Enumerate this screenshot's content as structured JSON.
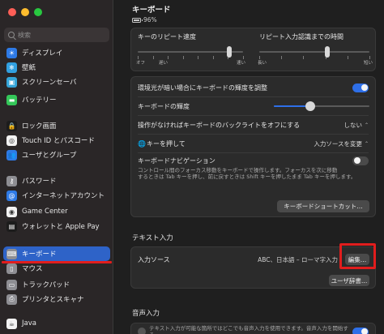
{
  "window": {
    "traffic_lights": [
      "#ff5f57",
      "#febc2e",
      "#28c840"
    ]
  },
  "sidebar": {
    "search_placeholder": "検索",
    "items": [
      {
        "label": "ディスプレイ",
        "icon": "display-icon",
        "color": "#2e7ae6",
        "glyph": "☀"
      },
      {
        "label": "壁紙",
        "icon": "wallpaper-icon",
        "color": "#31a0e0",
        "glyph": "❄"
      },
      {
        "label": "スクリーンセーバ",
        "icon": "screensaver-icon",
        "color": "#35a5d8",
        "glyph": "▣"
      },
      {
        "label": "バッテリー",
        "icon": "battery-icon",
        "color": "#34c759",
        "glyph": "▬"
      },
      {
        "label": "ロック画面",
        "icon": "lock-icon",
        "color": "#1c1c1c",
        "glyph": "🔒"
      },
      {
        "label": "Touch ID とパスコード",
        "icon": "fingerprint-icon",
        "color": "#f2f2f2",
        "glyph": "◎"
      },
      {
        "label": "ユーザとグループ",
        "icon": "users-icon",
        "color": "#2e7ae6",
        "glyph": "👥"
      },
      {
        "label": "パスワード",
        "icon": "key-icon",
        "color": "#8e8e93",
        "glyph": "⚷"
      },
      {
        "label": "インターネットアカウント",
        "icon": "at-icon",
        "color": "#2e7ae6",
        "glyph": "@"
      },
      {
        "label": "Game Center",
        "icon": "gamecenter-icon",
        "color": "#f2f2f2",
        "glyph": "◉"
      },
      {
        "label": "ウォレットと Apple Pay",
        "icon": "wallet-icon",
        "color": "#1c1c1c",
        "glyph": "▤"
      },
      {
        "label": "キーボード",
        "icon": "keyboard-icon",
        "color": "#8e8e93",
        "glyph": "⌨",
        "selected": true
      },
      {
        "label": "マウス",
        "icon": "mouse-icon",
        "color": "#8e8e93",
        "glyph": "▯"
      },
      {
        "label": "トラックパッド",
        "icon": "trackpad-icon",
        "color": "#8e8e93",
        "glyph": "▭"
      },
      {
        "label": "プリンタとスキャナ",
        "icon": "printer-icon",
        "color": "#8e8e93",
        "glyph": "⎙"
      },
      {
        "label": "Java",
        "icon": "java-icon",
        "color": "#f2f2f2",
        "glyph": "☕"
      }
    ]
  },
  "header": {
    "title": "キーボード",
    "battery": "96%"
  },
  "repeat": {
    "key_repeat_label": "キーのリピート速度",
    "delay_label": "リピート入力認識までの時間",
    "off": "オフ",
    "slow": "遅い",
    "fast": "速い",
    "long": "長い",
    "short": "短い",
    "key_repeat_value": 0.87,
    "delay_value": 0.62
  },
  "settings": {
    "adjust_brightness_label": "環境光が暗い場合にキーボードの輝度を調整",
    "adjust_brightness_on": true,
    "brightness_label": "キーボードの輝度",
    "brightness_value": 0.38,
    "backlight_off_label": "操作がなければキーボードのバックライトをオフにする",
    "backlight_off_value": "しない",
    "globe_key_label": "キーを押して",
    "globe_key_value": "入力ソースを変更",
    "keyboard_nav_label": "キーボードナビゲーション",
    "keyboard_nav_on": false,
    "keyboard_nav_desc_1": "コントロール間のフォーカス移動をキーボードで操作します。フォーカスを次に移動",
    "keyboard_nav_desc_2": "するときは Tab キーを押し、前に戻すときは Shift キーを押したまま Tab キーを押します。",
    "shortcuts_button": "キーボードショートカット…"
  },
  "text_input": {
    "section_title": "テキスト入力",
    "input_sources_label": "入力ソース",
    "input_sources_value": "ABC、日本語 – ローマ字入力",
    "edit_button": "編集…",
    "user_dict_button": "ユーザ辞書…"
  },
  "dictation": {
    "section_title": "音声入力",
    "desc": "テキスト入力が可能な箇所ではどこでも音声入力を使用できます。音声入力を開始する"
  },
  "colors": {
    "accent": "#2e6fe8",
    "annotation": "#e11d1d"
  }
}
